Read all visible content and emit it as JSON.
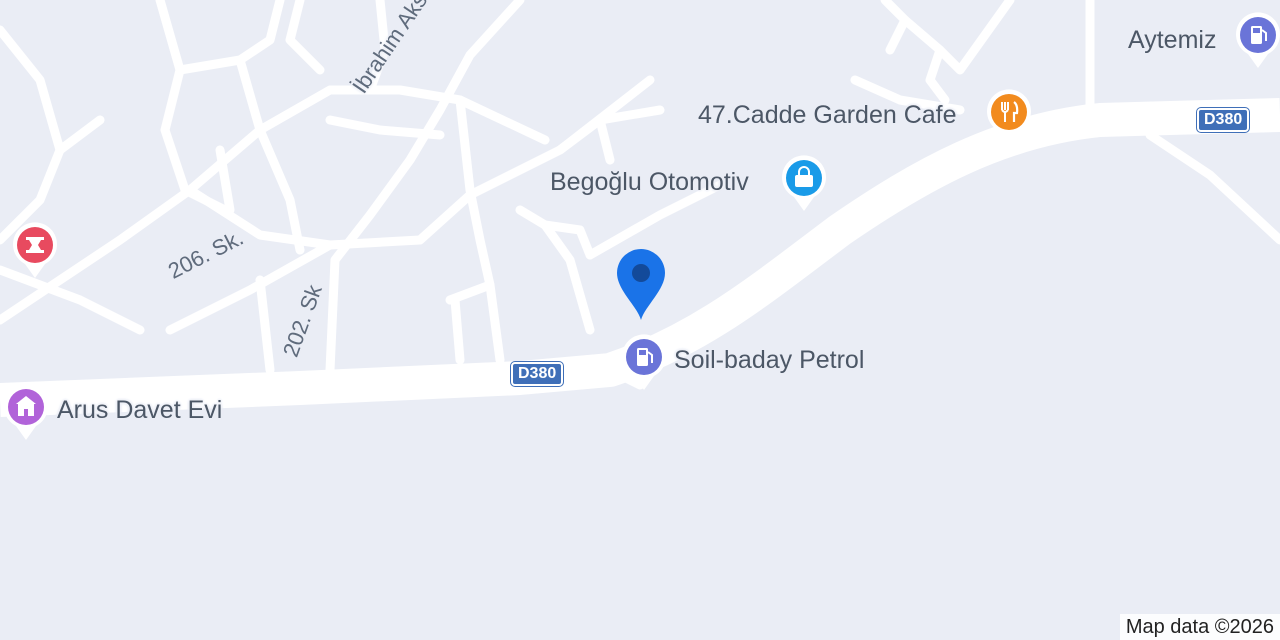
{
  "map": {
    "background": "#eaedf5",
    "road_color": "#ffffff",
    "attribution": "Map data ©2026"
  },
  "places": {
    "aytemiz": {
      "label": "Aytemiz",
      "icon": "fuel-icon",
      "color": "#6a74d8"
    },
    "garden_cafe": {
      "label": "47.Cadde Garden Cafe",
      "icon": "restaurant-icon",
      "color": "#f28b1e"
    },
    "begoglu": {
      "label": "Begoğlu Otomotiv",
      "icon": "shopping-bag-icon",
      "color": "#1a9be8"
    },
    "soil_baday": {
      "label": "Soil-baday Petrol",
      "icon": "fuel-icon",
      "color": "#6a74d8"
    },
    "arus": {
      "label": "Arus Davet Evi",
      "icon": "event-venue-icon",
      "color": "#b163d9"
    },
    "pharmacy": {
      "label": "",
      "icon": "pharmacy-icon",
      "color": "#e84a5f"
    }
  },
  "streets": {
    "ibrahim": "İbrahim Aksın Cd.",
    "sk206": "206. Sk.",
    "sk202": "202. Sk"
  },
  "shields": {
    "d380_left": "D380",
    "d380_right": "D380"
  },
  "marker": {
    "icon": "location-pin-icon",
    "color": "#1a73e8"
  }
}
